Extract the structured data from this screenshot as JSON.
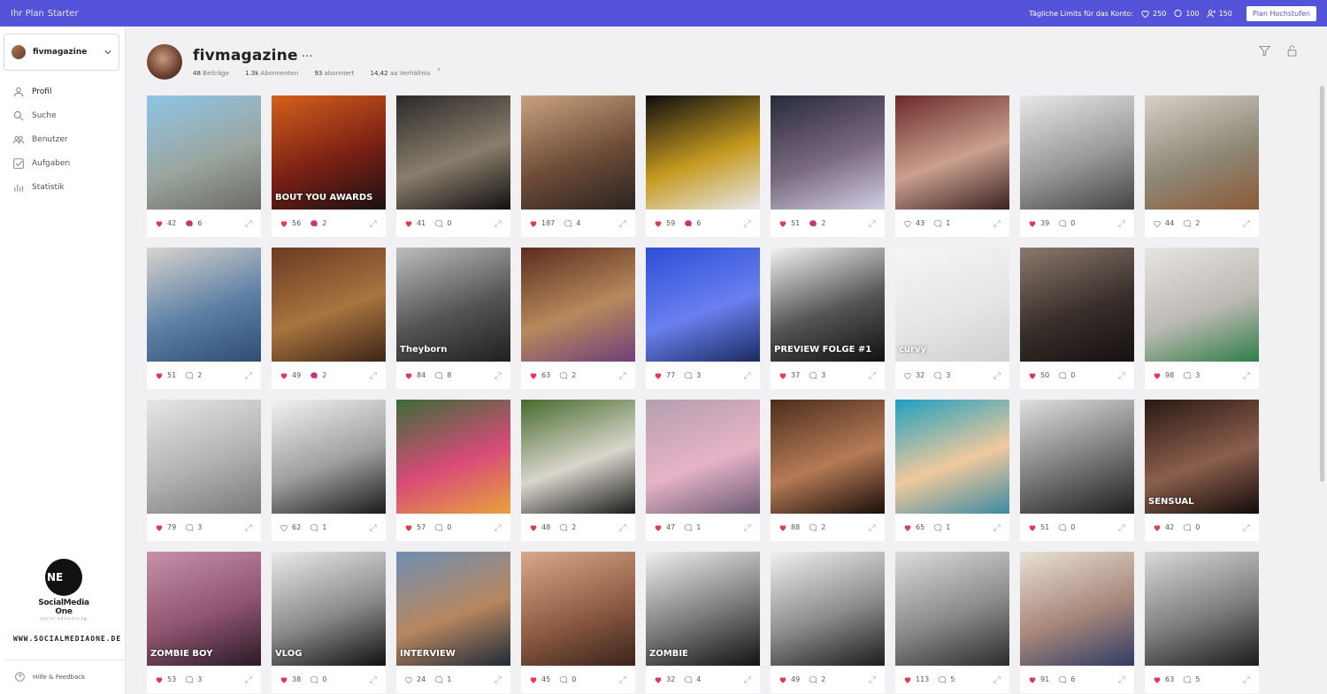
{
  "topbar": {
    "plan_label": "Ihr Plan",
    "plan_name": "Starter",
    "limits_label": "Tägliche Limits für das Konto:",
    "limit_likes": "250",
    "limit_comments": "100",
    "limit_follows": "150",
    "upgrade_label": "Plan Hochstufen"
  },
  "sidebar": {
    "account": "fivmagazine",
    "items": [
      {
        "label": "Profil",
        "icon": "user-icon"
      },
      {
        "label": "Suche",
        "icon": "search-icon"
      },
      {
        "label": "Benutzer",
        "icon": "users-icon"
      },
      {
        "label": "Aufgaben",
        "icon": "tasks-icon"
      },
      {
        "label": "Statistik",
        "icon": "stats-icon"
      }
    ],
    "logo_initials": "NE",
    "logo_name": "SocialMedia One",
    "logo_tagline": "social advertising",
    "website": "WWW.SOCIALMEDIAONE.DE",
    "help_label": "Hilfe & Feedback"
  },
  "profile": {
    "name": "fivmagazine",
    "dots": "···",
    "posts_value": "48",
    "posts_label": "Beiträge",
    "followers_value": "1.3k",
    "followers_label": "Abonnenten",
    "following_value": "93",
    "following_label": "abonniert",
    "ratio_value": "14,42",
    "ratio_label": "aa Verhältnis",
    "ratio_sup": "?"
  },
  "colors": {
    "accent": "#5553d9",
    "like": "#e23b4f",
    "comment_active": "#c5337d"
  },
  "posts": [
    {
      "likes": "42",
      "comments": "6",
      "liked": true,
      "commented": true,
      "colors": [
        "#8fc4e6",
        "#9aa6a0",
        "#6d6a63"
      ]
    },
    {
      "likes": "56",
      "comments": "2",
      "liked": true,
      "commented": true,
      "colors": [
        "#d4611c",
        "#7b2014",
        "#1a1212"
      ],
      "caption": "BOUT YOU AWARDS"
    },
    {
      "likes": "41",
      "comments": "0",
      "liked": true,
      "commented": false,
      "colors": [
        "#2a2a2a",
        "#8a7d6b",
        "#111"
      ]
    },
    {
      "likes": "187",
      "comments": "4",
      "liked": true,
      "commented": false,
      "colors": [
        "#c9a27f",
        "#6e4c38",
        "#2b2320"
      ]
    },
    {
      "likes": "59",
      "comments": "6",
      "liked": true,
      "commented": true,
      "colors": [
        "#0d0d10",
        "#c59a20",
        "#e8e8ef"
      ]
    },
    {
      "likes": "51",
      "comments": "2",
      "liked": true,
      "commented": true,
      "colors": [
        "#272a3c",
        "#7b6a7f",
        "#d0cfe4"
      ]
    },
    {
      "likes": "43",
      "comments": "1",
      "liked": false,
      "commented": false,
      "colors": [
        "#6a2a2a",
        "#caa08e",
        "#3a2222"
      ]
    },
    {
      "likes": "39",
      "comments": "0",
      "liked": true,
      "commented": false,
      "colors": [
        "#e8e8e8",
        "#9a9a9a",
        "#444"
      ]
    },
    {
      "likes": "44",
      "comments": "2",
      "liked": false,
      "commented": false,
      "colors": [
        "#d6d0c7",
        "#8f8878",
        "#8b5a36"
      ]
    },
    {
      "likes": "51",
      "comments": "2",
      "liked": true,
      "commented": false,
      "colors": [
        "#d9d4ce",
        "#5c7fa4",
        "#2e4d72"
      ]
    },
    {
      "likes": "49",
      "comments": "2",
      "liked": true,
      "commented": true,
      "colors": [
        "#6b3a22",
        "#a8743f",
        "#3d2416"
      ]
    },
    {
      "likes": "84",
      "comments": "8",
      "liked": true,
      "commented": false,
      "colors": [
        "#bdbdbd",
        "#555",
        "#1f1f1f"
      ],
      "caption": "Theyborn"
    },
    {
      "likes": "63",
      "comments": "2",
      "liked": true,
      "commented": false,
      "colors": [
        "#5b2c1e",
        "#b7895c",
        "#6f3f7a"
      ]
    },
    {
      "likes": "77",
      "comments": "3",
      "liked": true,
      "commented": false,
      "colors": [
        "#2c4fd6",
        "#6a7ff0",
        "#1b2a60"
      ]
    },
    {
      "likes": "37",
      "comments": "3",
      "liked": true,
      "commented": false,
      "colors": [
        "#f2f2f2",
        "#555",
        "#111"
      ],
      "caption": "PREVIEW FOLGE #1"
    },
    {
      "likes": "32",
      "comments": "3",
      "liked": false,
      "commented": false,
      "colors": [
        "#f5f5f5",
        "#e6e6e6",
        "#cfcfcf"
      ],
      "caption": "curvy"
    },
    {
      "likes": "50",
      "comments": "0",
      "liked": true,
      "commented": false,
      "colors": [
        "#8a7a6e",
        "#3a2f2a",
        "#141012"
      ]
    },
    {
      "likes": "98",
      "comments": "3",
      "liked": true,
      "commented": false,
      "colors": [
        "#e7e5e2",
        "#bdb9b3",
        "#2f7e46"
      ]
    },
    {
      "likes": "79",
      "comments": "3",
      "liked": true,
      "commented": false,
      "colors": [
        "#e6e6e6",
        "#b2b2b2",
        "#797979"
      ]
    },
    {
      "likes": "62",
      "comments": "1",
      "liked": false,
      "commented": false,
      "colors": [
        "#f2f2f2",
        "#9f9f9f",
        "#1a1a1a"
      ]
    },
    {
      "likes": "57",
      "comments": "0",
      "liked": true,
      "commented": false,
      "colors": [
        "#3c6c38",
        "#d84b78",
        "#e8a23c"
      ]
    },
    {
      "likes": "48",
      "comments": "2",
      "liked": true,
      "commented": false,
      "colors": [
        "#476b2d",
        "#d9d6cc",
        "#1b1b1b"
      ]
    },
    {
      "likes": "47",
      "comments": "1",
      "liked": true,
      "commented": false,
      "colors": [
        "#b59fae",
        "#e6b3c6",
        "#6b5a73"
      ]
    },
    {
      "likes": "88",
      "comments": "2",
      "liked": true,
      "commented": false,
      "colors": [
        "#4c2d1d",
        "#b57b56",
        "#1a0d0a"
      ]
    },
    {
      "likes": "65",
      "comments": "1",
      "liked": true,
      "commented": false,
      "colors": [
        "#1fa0bf",
        "#f0c99e",
        "#3c8aa1"
      ]
    },
    {
      "likes": "51",
      "comments": "0",
      "liked": true,
      "commented": false,
      "colors": [
        "#e0e0e0",
        "#777",
        "#1e1e1e"
      ]
    },
    {
      "likes": "42",
      "comments": "0",
      "liked": true,
      "commented": false,
      "colors": [
        "#2a1914",
        "#8b5f4c",
        "#120b09"
      ],
      "caption": "SENSUAL"
    },
    {
      "likes": "53",
      "comments": "3",
      "liked": true,
      "commented": false,
      "colors": [
        "#c791ab",
        "#8e5470",
        "#2a1a24"
      ],
      "caption": "ZOMBIE BOY"
    },
    {
      "likes": "38",
      "comments": "0",
      "liked": true,
      "commented": false,
      "colors": [
        "#eaeaea",
        "#8a8a8a",
        "#111"
      ],
      "caption": "VLOG"
    },
    {
      "likes": "24",
      "comments": "1",
      "liked": false,
      "commented": false,
      "colors": [
        "#6f8fb3",
        "#b7865f",
        "#1f2a38"
      ],
      "caption": "INTERVIEW"
    },
    {
      "likes": "45",
      "comments": "0",
      "liked": true,
      "commented": false,
      "colors": [
        "#d8a98c",
        "#8f5d44",
        "#3a231a"
      ]
    },
    {
      "likes": "32",
      "comments": "4",
      "liked": true,
      "commented": false,
      "colors": [
        "#efefef",
        "#7a7a7a",
        "#121212"
      ],
      "caption": "ZOMBIE"
    },
    {
      "likes": "49",
      "comments": "2",
      "liked": true,
      "commented": false,
      "colors": [
        "#f0f0f0",
        "#8c8c8c",
        "#1c1c1c"
      ]
    },
    {
      "likes": "113",
      "comments": "5",
      "liked": true,
      "commented": false,
      "colors": [
        "#dcdcdc",
        "#8a8a8a",
        "#2c2c2c"
      ]
    },
    {
      "likes": "91",
      "comments": "6",
      "liked": true,
      "commented": false,
      "colors": [
        "#e9e1d5",
        "#a7877a",
        "#303b66"
      ]
    },
    {
      "likes": "63",
      "comments": "5",
      "liked": true,
      "commented": false,
      "colors": [
        "#d9d9d9",
        "#7e7e7e",
        "#1b1b1b"
      ]
    }
  ]
}
